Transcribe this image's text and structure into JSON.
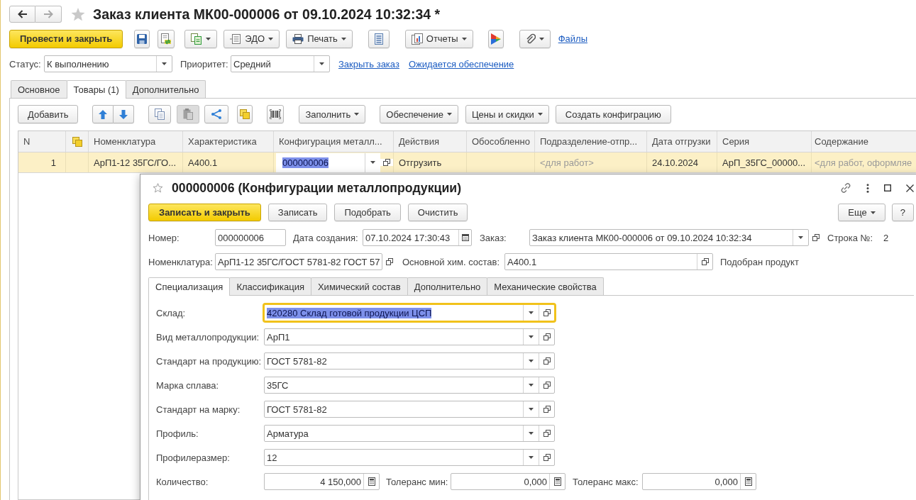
{
  "window": {
    "title": "Заказ клиента МК00-000006 от 09.10.2024 10:32:34 *"
  },
  "toolbar": {
    "post_button": "Провести и закрыть",
    "edo_button": "ЭДО",
    "print_button": "Печать",
    "reports_button": "Отчеты",
    "files_link": "Файлы"
  },
  "status_fields": [
    {
      "label": "Статус:",
      "value": "К выполнению"
    },
    {
      "label": "Приоритет:",
      "value": "Средний"
    }
  ],
  "links": [
    "Закрыть заказ",
    "Ожидается обеспечение"
  ],
  "tabs": [
    {
      "label": "Основное",
      "selected": false
    },
    {
      "label": "Товары (1)",
      "selected": true
    },
    {
      "label": "Дополнительно",
      "selected": false
    }
  ],
  "table_toolbar": {
    "add_button": "Добавить",
    "paste_button": {
      "disabled": true
    },
    "menu_buttons": [
      "Заполнить",
      "Обеспечение",
      "Цены и скидки"
    ],
    "create_button": "Создать конфиграцию"
  },
  "table": {
    "columns": [
      {
        "kind": "text",
        "label": "N"
      },
      {
        "kind": "icon"
      },
      {
        "kind": "text",
        "label": "Номенклатура"
      },
      {
        "kind": "text",
        "label": "Характеристика"
      },
      {
        "kind": "text",
        "label": "Конфигурация металл..."
      },
      {
        "kind": "text",
        "label": "Действия"
      },
      {
        "kind": "text",
        "label": "Обособленно"
      },
      {
        "kind": "text",
        "label": "Подразделение-отпр..."
      },
      {
        "kind": "text",
        "label": "Дата отгрузки"
      },
      {
        "kind": "text",
        "label": "Серия"
      },
      {
        "kind": "text",
        "label": "Содержание"
      }
    ],
    "rows": [
      {
        "selected": true,
        "cells": [
          {
            "kind": "number",
            "text": "1"
          },
          {
            "kind": "empty"
          },
          {
            "kind": "text",
            "text": "АрП1-12 35ГС/ГО..."
          },
          {
            "kind": "text",
            "text": "А400.1"
          },
          {
            "kind": "editor",
            "text": "000000006"
          },
          {
            "kind": "text",
            "text": "Отгрузить"
          },
          {
            "kind": "empty"
          },
          {
            "kind": "placeholder",
            "text": "<для работ>"
          },
          {
            "kind": "text",
            "text": "24.10.2024"
          },
          {
            "kind": "text",
            "text": "АрП_35ГС_00000..."
          },
          {
            "kind": "placeholder",
            "text": "<для работ, оформляе"
          }
        ]
      }
    ]
  },
  "dialog": {
    "title": "000000006 (Конфигурации металлопродукции)",
    "buttons": [
      {
        "kind": "primary",
        "label": "Записать и закрыть"
      },
      {
        "kind": "normal",
        "label": "Записать"
      },
      {
        "kind": "normal",
        "label": "Подобрать"
      },
      {
        "kind": "normal",
        "label": "Очистить"
      }
    ],
    "more_button": "Еще",
    "help_button": "?",
    "header_rows": [
      [
        {
          "kind": "plain",
          "label": "Номер:",
          "value": "000000006"
        },
        {
          "kind": "date",
          "label": "Дата создания:",
          "value": "07.10.2024 17:30:43"
        },
        {
          "kind": "select",
          "label": "Заказ:",
          "value": "Заказ клиента МК00-000006 от 09.10.2024 10:32:34"
        },
        {
          "kind": "static",
          "label": "Строка №:",
          "value": "2"
        }
      ],
      [
        {
          "kind": "link",
          "label": "Номенклатура:",
          "value": "АрП1-12 35ГС/ГОСТ 5781-82 ГОСТ 57"
        },
        {
          "kind": "lookup",
          "label": "Основной хим. состав:",
          "value": "А400.1"
        },
        {
          "kind": "note",
          "text": "Подобран продукт"
        }
      ]
    ],
    "tabs": [
      {
        "label": "Специализация",
        "selected": true
      },
      {
        "label": "Классификация",
        "selected": false
      },
      {
        "label": "Химический состав",
        "selected": false
      },
      {
        "label": "Дополнительно",
        "selected": false
      },
      {
        "label": "Механические свойства",
        "selected": false
      }
    ],
    "fields": [
      {
        "label": "Склад:",
        "value": "420280 Склад готовой продукции ЦСП",
        "focused": true
      },
      {
        "label": "Вид металлопродукции:",
        "value": "АрП1",
        "focused": false
      },
      {
        "label": "Стандарт на продукцию:",
        "value": "ГОСТ 5781-82",
        "focused": false
      },
      {
        "label": "Марка сплава:",
        "value": "35ГС",
        "focused": false
      },
      {
        "label": "Стандарт на марку:",
        "value": "ГОСТ 5781-82",
        "focused": false
      },
      {
        "label": "Профиль:",
        "value": "Арматура",
        "focused": false
      },
      {
        "label": "Профилеразмер:",
        "value": "12",
        "focused": false
      }
    ],
    "quantity_fields": [
      {
        "label": "Количество:",
        "value": "4 150,000"
      },
      {
        "label": "Толеранс мин:",
        "value": "0,000"
      },
      {
        "label": "Толеранс макс:",
        "value": "0,000"
      }
    ]
  }
}
